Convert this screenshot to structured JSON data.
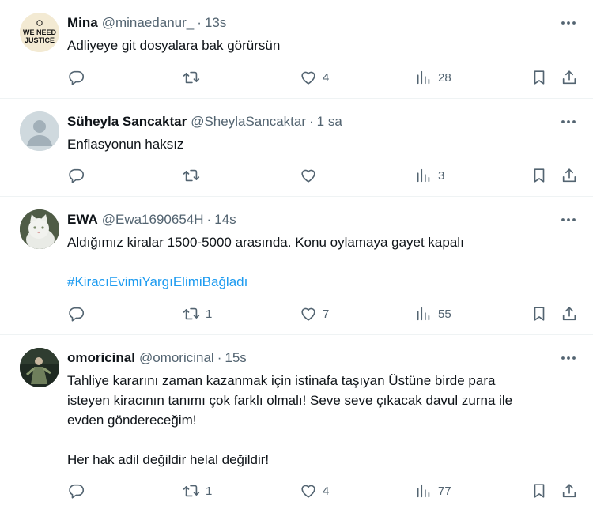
{
  "tweets": [
    {
      "name": "Mina",
      "handle": "@minaedanur_",
      "separator": "·",
      "time": "13s",
      "avatar_text_1": "WE NEED",
      "avatar_text_2": "JUSTICE",
      "lines": [
        "Adliyeye git dosyalara bak görürsün"
      ],
      "hashtag": "",
      "retweets": "",
      "likes": "4",
      "views": "28"
    },
    {
      "name": "Süheyla Sancaktar",
      "handle": "@SheylaSancaktar",
      "separator": "·",
      "time": "1 sa",
      "lines": [
        "Enflasyonun haksız"
      ],
      "hashtag": "",
      "retweets": "",
      "likes": "",
      "views": "3"
    },
    {
      "name": "EWA",
      "handle": "@Ewa1690654H",
      "separator": "·",
      "time": "14s",
      "lines": [
        "Aldığımız kiralar 1500-5000 arasında. Konu oylamaya gayet kapalı"
      ],
      "hashtag": "#KiracıEvimiYargıElimiBağladı",
      "retweets": "1",
      "likes": "7",
      "views": "55"
    },
    {
      "name": "omoricinal",
      "handle": "@omoricinal",
      "separator": "·",
      "time": "15s",
      "lines": [
        "Tahliye kararını zaman kazanmak için istinafa taşıyan Üstüne birde para",
        "isteyen  kiracının tanımı çok farklı olmalı!  Seve seve çıkacak davul zurna ile",
        "evden göndereceğim!",
        "",
        "Her hak adil değildir helal değildir!"
      ],
      "hashtag": "",
      "retweets": "1",
      "likes": "4",
      "views": "77"
    }
  ],
  "colors": {
    "text": "#0f1419",
    "secondary": "#536471",
    "link": "#1d9bf0",
    "divider": "#eff3f4"
  },
  "icons": [
    "more-icon",
    "reply-icon",
    "retweet-icon",
    "like-icon",
    "views-icon",
    "bookmark-icon",
    "share-icon"
  ]
}
